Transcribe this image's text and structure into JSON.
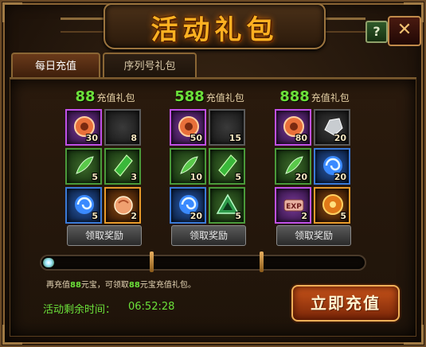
{
  "window": {
    "title": "活动礼包",
    "help_label": "?",
    "close_label": "✕"
  },
  "tabs": [
    {
      "label": "每日充值",
      "active": true
    },
    {
      "label": "序列号礼包",
      "active": false
    }
  ],
  "packages": [
    {
      "amount": "88",
      "label": "充值礼包",
      "claim_label": "领取奖励",
      "items": [
        {
          "icon": "orange-jade-disc-icon",
          "rarity": "purple",
          "count": "30"
        },
        {
          "icon": "empty-slot-icon",
          "rarity": "gray",
          "count": "8"
        },
        {
          "icon": "green-feather-scroll-icon",
          "rarity": "green",
          "count": "5"
        },
        {
          "icon": "green-crystal-icon",
          "rarity": "green",
          "count": "3"
        },
        {
          "icon": "blue-swirl-orb-icon",
          "rarity": "blue",
          "count": "5"
        },
        {
          "icon": "meat-bun-icon",
          "rarity": "orange",
          "count": "2"
        }
      ]
    },
    {
      "amount": "588",
      "label": "充值礼包",
      "claim_label": "领取奖励",
      "items": [
        {
          "icon": "orange-jade-disc-icon",
          "rarity": "purple",
          "count": "50"
        },
        {
          "icon": "empty-slot-icon",
          "rarity": "gray",
          "count": "15"
        },
        {
          "icon": "green-feather-scroll-icon",
          "rarity": "green",
          "count": "10"
        },
        {
          "icon": "green-crystal-icon",
          "rarity": "green",
          "count": "5"
        },
        {
          "icon": "blue-swirl-orb-icon",
          "rarity": "blue",
          "count": "20"
        },
        {
          "icon": "green-triangle-rune-icon",
          "rarity": "green",
          "count": "5"
        }
      ]
    },
    {
      "amount": "888",
      "label": "充值礼包",
      "claim_label": "领取奖励",
      "items": [
        {
          "icon": "orange-jade-disc-icon",
          "rarity": "purple",
          "count": "80"
        },
        {
          "icon": "silver-ore-icon",
          "rarity": "gray",
          "count": "20"
        },
        {
          "icon": "green-feather-scroll-icon",
          "rarity": "green",
          "count": "20"
        },
        {
          "icon": "blue-swirl-orb-icon",
          "rarity": "blue",
          "count": "20"
        },
        {
          "icon": "exp-scroll-icon",
          "rarity": "purple",
          "count": "2"
        },
        {
          "icon": "golden-treasure-orb-icon",
          "rarity": "orange",
          "count": "5"
        }
      ]
    }
  ],
  "progress": {
    "fraction": 0.03
  },
  "hint": {
    "pre": "再充值",
    "amount1": "88",
    "mid": "元宝，可领取",
    "amount2": "88",
    "post": "元宝充值礼包。"
  },
  "timer": {
    "label": "活动剩余时间：",
    "value": "06:52:28"
  },
  "recharge_label": "立即充值",
  "colors": {
    "accent_green": "#6be03a",
    "title_gold": "#ffb021",
    "button_orange": "#c8541a"
  }
}
